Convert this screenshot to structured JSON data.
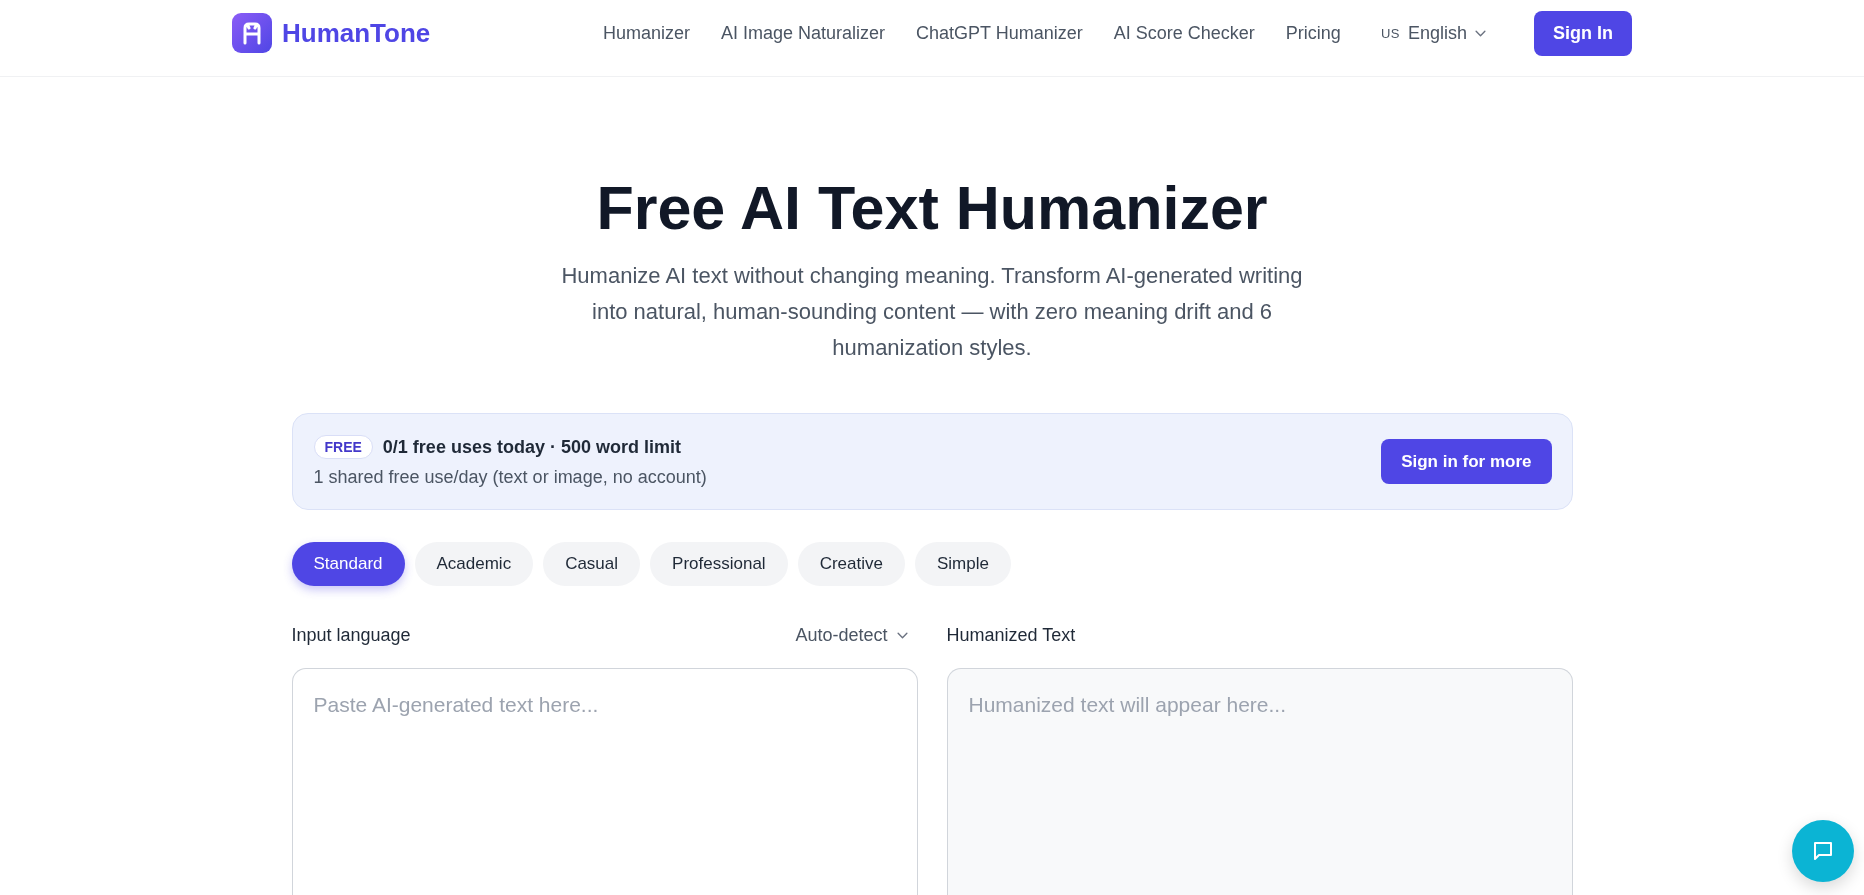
{
  "header": {
    "brand": "HumanTone",
    "nav": [
      "Humanizer",
      "AI Image Naturalizer",
      "ChatGPT Humanizer",
      "AI Score Checker",
      "Pricing"
    ],
    "language": {
      "flag": "US",
      "label": "English"
    },
    "sign_in": "Sign In"
  },
  "hero": {
    "title": "Free AI Text Humanizer",
    "subtitle": "Humanize AI text without changing meaning. Transform AI-generated writing into natural, human-sounding content — with zero meaning drift and 6 humanization styles."
  },
  "usage_banner": {
    "badge": "FREE",
    "usage": "0/1 free uses today · 500 word limit",
    "note": "1 shared free use/day (text or image, no account)",
    "button": "Sign in for more"
  },
  "styles": [
    {
      "label": "Standard",
      "selected": true
    },
    {
      "label": "Academic",
      "selected": false
    },
    {
      "label": "Casual",
      "selected": false
    },
    {
      "label": "Professional",
      "selected": false
    },
    {
      "label": "Creative",
      "selected": false
    },
    {
      "label": "Simple",
      "selected": false
    }
  ],
  "input": {
    "label": "Input language",
    "language": "Auto-detect",
    "placeholder": "Paste AI-generated text here..."
  },
  "output": {
    "label": "Humanized Text",
    "placeholder": "Humanized text will appear here..."
  }
}
